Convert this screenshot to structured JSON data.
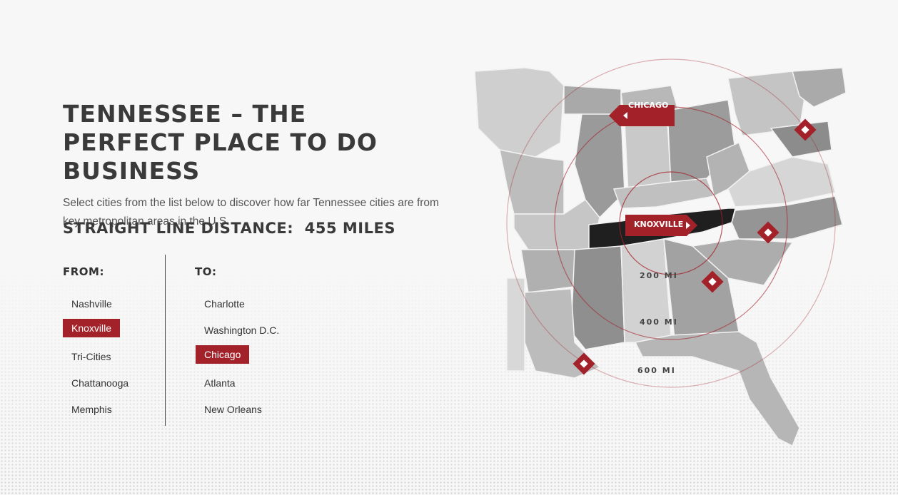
{
  "header": {
    "title": "TENNESSEE – THE PERFECT PLACE TO DO BUSINESS",
    "intro": "Select cities from the list below to discover how far Tennessee cities are from key metropolitan areas in the U.S."
  },
  "distance": {
    "label": "STRAIGHT LINE DISTANCE:",
    "value": "455 MILES"
  },
  "from": {
    "heading": "FROM:",
    "items": [
      "Nashville",
      "Knoxville",
      "Tri-Cities",
      "Chattanooga",
      "Memphis"
    ],
    "selected": "Knoxville"
  },
  "to": {
    "heading": "TO:",
    "items": [
      "Charlotte",
      "Washington D.C.",
      "Chicago",
      "Atlanta",
      "New Orleans"
    ],
    "selected": "Chicago"
  },
  "map": {
    "origin_label": "KNOXVILLE",
    "destination_label": "CHICAGO",
    "rings": [
      "200 MI",
      "400 MI",
      "600 MI"
    ]
  },
  "colors": {
    "accent": "#a3222a",
    "text": "#3a3a3a",
    "highlight_state": "#1f1f1f"
  }
}
